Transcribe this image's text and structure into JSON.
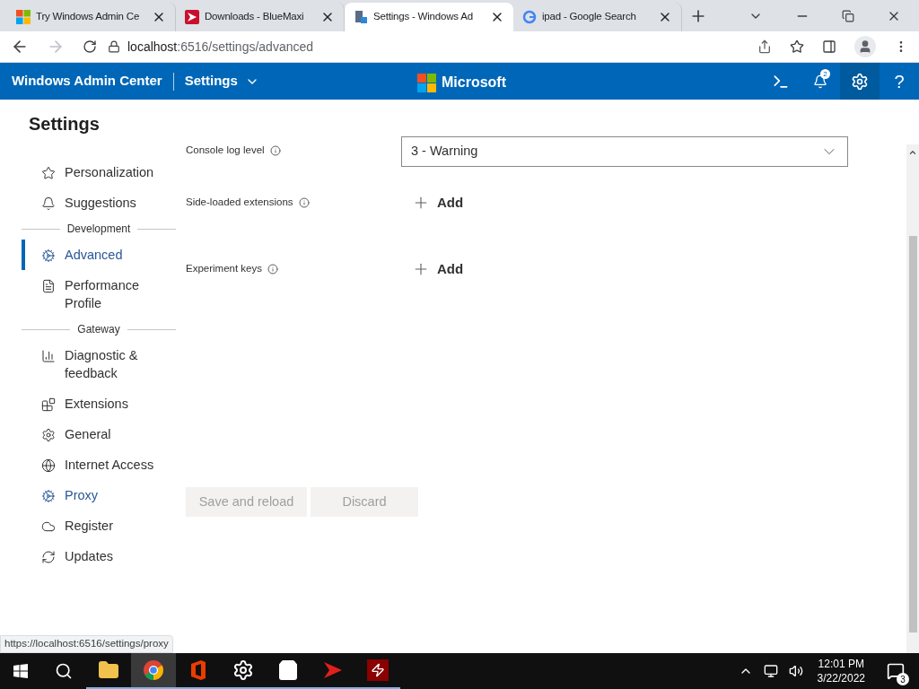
{
  "browser": {
    "tabs": [
      {
        "title": "Try Windows Admin Ce",
        "selected": false
      },
      {
        "title": "Downloads - BlueMaxi",
        "selected": false
      },
      {
        "title": "Settings - Windows Ad",
        "selected": true
      },
      {
        "title": "ipad - Google Search",
        "selected": false
      }
    ],
    "url_host": "localhost",
    "url_rest": ":6516/settings/advanced"
  },
  "app_header": {
    "title": "Windows Admin Center",
    "menu": "Settings",
    "brand": "Microsoft",
    "notification_count": "2",
    "help": "?"
  },
  "sidebar": {
    "title": "Settings",
    "items": [
      {
        "kind": "item",
        "label": "Personalization",
        "selected": false,
        "hovered": false
      },
      {
        "kind": "item",
        "label": "Suggestions",
        "selected": false,
        "hovered": false
      },
      {
        "kind": "section",
        "label": "Development"
      },
      {
        "kind": "item",
        "label": "Advanced",
        "selected": true,
        "hovered": false
      },
      {
        "kind": "item",
        "label": "Performance Profile",
        "selected": false,
        "hovered": false
      },
      {
        "kind": "section",
        "label": "Gateway"
      },
      {
        "kind": "item",
        "label": "Diagnostic & feedback",
        "selected": false,
        "hovered": false
      },
      {
        "kind": "item",
        "label": "Extensions",
        "selected": false,
        "hovered": false
      },
      {
        "kind": "item",
        "label": "General",
        "selected": false,
        "hovered": false
      },
      {
        "kind": "item",
        "label": "Internet Access",
        "selected": false,
        "hovered": false
      },
      {
        "kind": "item",
        "label": "Proxy",
        "selected": false,
        "hovered": true
      },
      {
        "kind": "item",
        "label": "Register",
        "selected": false,
        "hovered": false
      },
      {
        "kind": "item",
        "label": "Updates",
        "selected": false,
        "hovered": false
      }
    ]
  },
  "settings": [
    {
      "label": "Console log level",
      "kind": "dropdown",
      "value": "3 - Warning"
    },
    {
      "label": "Side-loaded extensions",
      "kind": "add",
      "value": "Add"
    },
    {
      "label": "Experiment keys",
      "kind": "add",
      "value": "Add"
    }
  ],
  "buttons": [
    {
      "label": "Save and reload",
      "disabled": true
    },
    {
      "label": "Discard",
      "disabled": true
    }
  ],
  "status_url": "https://localhost:6516/settings/proxy",
  "taskbar": {
    "apps": [
      {
        "selected": false,
        "running": true
      },
      {
        "selected": true,
        "running": true
      },
      {
        "selected": false,
        "running": true
      },
      {
        "selected": false,
        "running": true
      },
      {
        "selected": false,
        "running": true
      },
      {
        "selected": false,
        "running": true
      },
      {
        "selected": false,
        "running": true
      }
    ],
    "time": "12:01 PM",
    "date": "3/22/2022",
    "notifications": "3"
  }
}
